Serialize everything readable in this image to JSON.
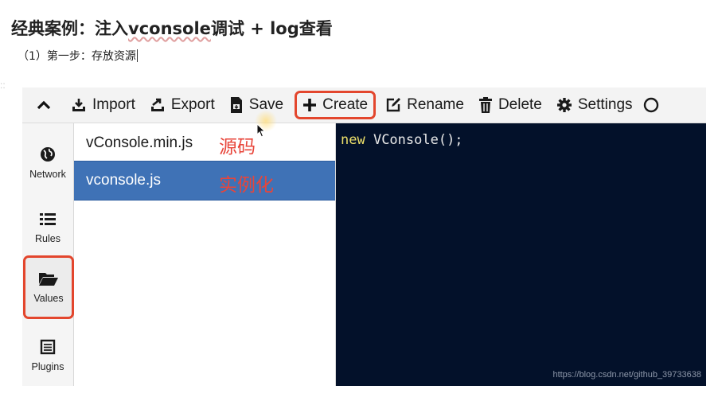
{
  "article": {
    "title_before": "经典案例：注入",
    "title_spell": "vconsole",
    "title_after": "调试 + log查看",
    "step": "（1）第一步：存放资源",
    "gutter_marker": "::"
  },
  "toolbar": {
    "collapse_icon": "chevron-up-icon",
    "buttons": [
      {
        "label": "Import",
        "icon": "import-icon"
      },
      {
        "label": "Export",
        "icon": "export-icon"
      },
      {
        "label": "Save",
        "icon": "save-icon"
      },
      {
        "label": "Create",
        "icon": "plus-icon",
        "highlighted": true
      },
      {
        "label": "Rename",
        "icon": "edit-icon"
      },
      {
        "label": "Delete",
        "icon": "trash-icon"
      },
      {
        "label": "Settings",
        "icon": "gear-icon"
      }
    ]
  },
  "sidebar": {
    "items": [
      {
        "label": "Network",
        "icon": "globe-icon"
      },
      {
        "label": "Rules",
        "icon": "list-icon"
      },
      {
        "label": "Values",
        "icon": "folder-open-icon",
        "active": true
      },
      {
        "label": "Plugins",
        "icon": "plugins-icon"
      }
    ]
  },
  "files": {
    "items": [
      {
        "name": "vConsole.min.js",
        "annotation": "源码",
        "selected": false
      },
      {
        "name": "vconsole.js",
        "annotation": "实例化",
        "selected": true
      }
    ]
  },
  "editor": {
    "keyword": "new",
    "code_rest": " VConsole();",
    "watermark": "https://blog.csdn.net/github_39733638"
  },
  "colors": {
    "highlight_border": "#e3462d",
    "annotation_text": "#e8453a",
    "selected_row": "#3f72b6",
    "editor_bg": "#03112a",
    "keyword": "#ede06a"
  }
}
